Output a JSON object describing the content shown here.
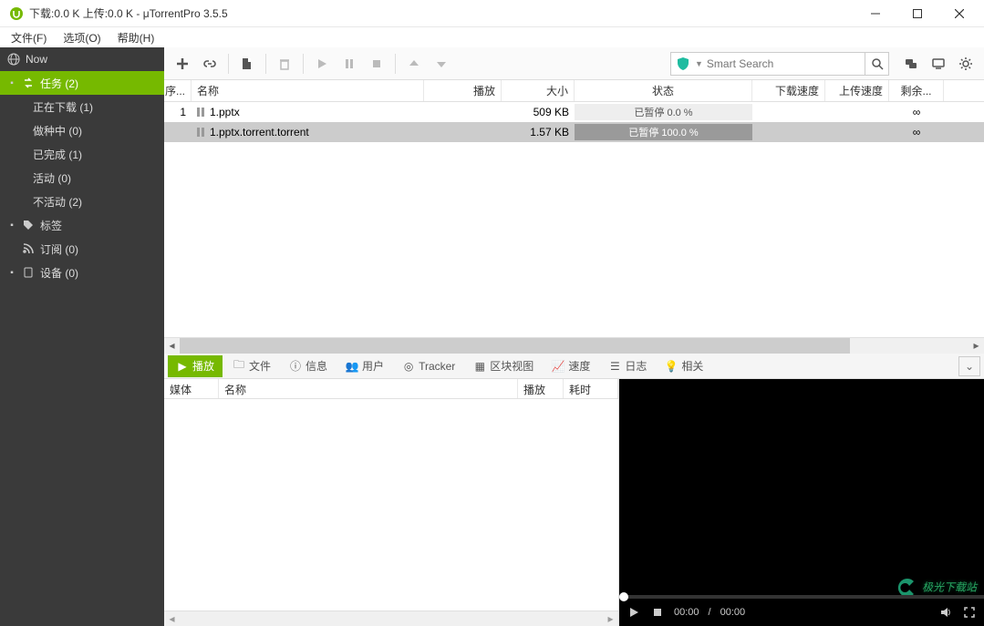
{
  "window": {
    "title": "下载:0.0 K 上传:0.0 K - μTorrentPro 3.5.5"
  },
  "menu": {
    "file": "文件(F)",
    "options": "选项(O)",
    "help": "帮助(H)"
  },
  "sidebar": {
    "now": "Now",
    "tasks": "任务 (2)",
    "downloading": "正在下载 (1)",
    "seeding": "做种中 (0)",
    "completed": "已完成 (1)",
    "active": "活动 (0)",
    "inactive": "不活动 (2)",
    "labels": "标签",
    "feeds": "订阅 (0)",
    "devices": "设备 (0)"
  },
  "search": {
    "placeholder": "Smart Search"
  },
  "columns": {
    "seq": "序...",
    "name": "名称",
    "play": "播放",
    "size": "大小",
    "status": "状态",
    "down": "下载速度",
    "up": "上传速度",
    "eta": "剩余..."
  },
  "rows": [
    {
      "seq": "1",
      "name": "1.pptx",
      "size": "509 KB",
      "status": "已暂停 0.0 %",
      "eta": "∞",
      "selected": false
    },
    {
      "seq": "",
      "name": "1.pptx.torrent.torrent",
      "size": "1.57 KB",
      "status": "已暂停 100.0 %",
      "eta": "∞",
      "selected": true
    }
  ],
  "tabs": {
    "playback": "播放",
    "files": "文件",
    "info": "信息",
    "peers": "用户",
    "tracker": "Tracker",
    "pieces": "区块视图",
    "speed": "速度",
    "log": "日志",
    "related": "相关"
  },
  "detail_cols": {
    "media": "媒体",
    "name": "名称",
    "play": "播放",
    "time": "耗时"
  },
  "player": {
    "cur": "00:00",
    "dur": "00:00",
    "sep": "/"
  },
  "watermark": "极光下载站"
}
